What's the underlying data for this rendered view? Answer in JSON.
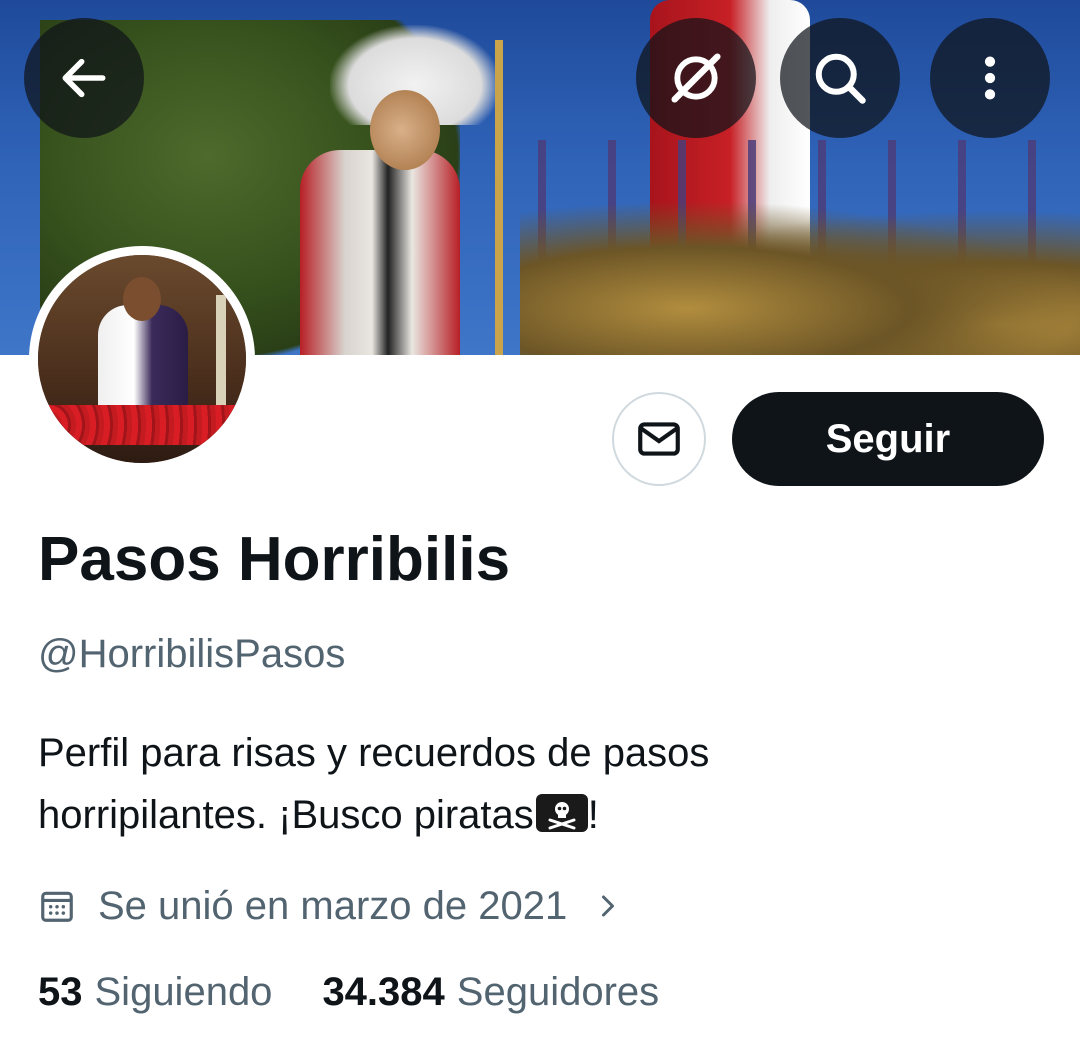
{
  "header": {
    "back_icon": "arrow-left-icon",
    "grok_icon": "grok-icon",
    "search_icon": "search-icon",
    "more_icon": "more-vertical-icon"
  },
  "actions": {
    "message_icon": "envelope-icon",
    "follow_label": "Seguir"
  },
  "profile": {
    "display_name": "Pasos Horribilis",
    "handle": "@HorribilisPasos",
    "bio_line1": "Perfil para risas y recuerdos de pasos",
    "bio_line2_text": "horripilantes. ¡Busco piratas",
    "bio_emoji": "pirate-flag-icon",
    "bio_line2_end": "!",
    "joined": "Se unió en marzo de 2021"
  },
  "stats": {
    "following_count": "53",
    "following_label": "Siguiendo",
    "followers_count": "34.384",
    "followers_label": "Seguidores"
  },
  "colors": {
    "text_primary": "#0f1419",
    "text_secondary": "#536471",
    "button_dark": "#0f1419",
    "border": "#cfd9de"
  }
}
